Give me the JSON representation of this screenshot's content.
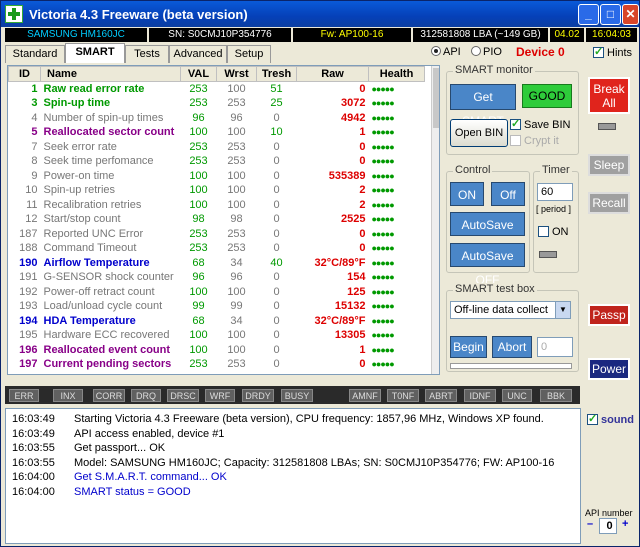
{
  "title": "Victoria 4.3 Freeware (beta version)",
  "window_buttons": {
    "minimize": "_",
    "maximize": "□",
    "close": "✕"
  },
  "infobar": {
    "model": "SAMSUNG HM160JC",
    "serial": "SN: S0CMJ10P354776",
    "firmware": "Fw: AP100-16",
    "capacity": "312581808 LBA (~149 GB)",
    "date": "04.02",
    "time": "16:04:03"
  },
  "tabs": [
    "Standard",
    "SMART",
    "Tests",
    "Advanced",
    "Setup"
  ],
  "api_radio": {
    "api": "API",
    "pio": "PIO"
  },
  "device": "Device 0",
  "hints": "Hints",
  "table": {
    "headers": [
      "ID",
      "Name",
      "VAL",
      "Wrst",
      "Tresh",
      "Raw",
      "Health"
    ],
    "rows": [
      {
        "id": "1",
        "name": "Raw read error rate",
        "val": "253",
        "wrst": "100",
        "tresh": "51",
        "raw": "0",
        "health": "●●●●●",
        "style": "green"
      },
      {
        "id": "3",
        "name": "Spin-up time",
        "val": "253",
        "wrst": "253",
        "tresh": "25",
        "raw": "3072",
        "health": "●●●●●",
        "style": "green"
      },
      {
        "id": "4",
        "name": "Number of spin-up times",
        "val": "96",
        "wrst": "96",
        "tresh": "0",
        "raw": "4942",
        "health": "●●●●●",
        "style": "grey"
      },
      {
        "id": "5",
        "name": "Reallocated sector count",
        "val": "100",
        "wrst": "100",
        "tresh": "10",
        "raw": "1",
        "health": "●●●●●",
        "style": "purple"
      },
      {
        "id": "7",
        "name": "Seek error rate",
        "val": "253",
        "wrst": "253",
        "tresh": "0",
        "raw": "0",
        "health": "●●●●●",
        "style": "grey"
      },
      {
        "id": "8",
        "name": "Seek time perfomance",
        "val": "253",
        "wrst": "253",
        "tresh": "0",
        "raw": "0",
        "health": "●●●●●",
        "style": "grey"
      },
      {
        "id": "9",
        "name": "Power-on time",
        "val": "100",
        "wrst": "100",
        "tresh": "0",
        "raw": "535389",
        "health": "●●●●●",
        "style": "grey"
      },
      {
        "id": "10",
        "name": "Spin-up retries",
        "val": "100",
        "wrst": "100",
        "tresh": "0",
        "raw": "2",
        "health": "●●●●●",
        "style": "grey"
      },
      {
        "id": "11",
        "name": "Recalibration retries",
        "val": "100",
        "wrst": "100",
        "tresh": "0",
        "raw": "2",
        "health": "●●●●●",
        "style": "grey"
      },
      {
        "id": "12",
        "name": "Start/stop count",
        "val": "98",
        "wrst": "98",
        "tresh": "0",
        "raw": "2525",
        "health": "●●●●●",
        "style": "grey"
      },
      {
        "id": "187",
        "name": "Reported UNC Error",
        "val": "253",
        "wrst": "253",
        "tresh": "0",
        "raw": "0",
        "health": "●●●●●",
        "style": "grey"
      },
      {
        "id": "188",
        "name": "Command Timeout",
        "val": "253",
        "wrst": "253",
        "tresh": "0",
        "raw": "0",
        "health": "●●●●●",
        "style": "grey"
      },
      {
        "id": "190",
        "name": "Airflow Temperature",
        "val": "68",
        "wrst": "34",
        "tresh": "40",
        "raw": "32°C/89°F",
        "health": "●●●●●",
        "style": "blue"
      },
      {
        "id": "191",
        "name": "G-SENSOR shock counter",
        "val": "96",
        "wrst": "96",
        "tresh": "0",
        "raw": "154",
        "health": "●●●●●",
        "style": "grey"
      },
      {
        "id": "192",
        "name": "Power-off retract count",
        "val": "100",
        "wrst": "100",
        "tresh": "0",
        "raw": "125",
        "health": "●●●●●",
        "style": "grey"
      },
      {
        "id": "193",
        "name": "Load/unload cycle count",
        "val": "99",
        "wrst": "99",
        "tresh": "0",
        "raw": "15132",
        "health": "●●●●●",
        "style": "grey"
      },
      {
        "id": "194",
        "name": "HDA Temperature",
        "val": "68",
        "wrst": "34",
        "tresh": "0",
        "raw": "32°C/89°F",
        "health": "●●●●●",
        "style": "blue"
      },
      {
        "id": "195",
        "name": "Hardware ECC recovered",
        "val": "100",
        "wrst": "100",
        "tresh": "0",
        "raw": "13305",
        "health": "●●●●●",
        "style": "grey"
      },
      {
        "id": "196",
        "name": "Reallocated event count",
        "val": "100",
        "wrst": "100",
        "tresh": "0",
        "raw": "1",
        "health": "●●●●●",
        "style": "purple"
      },
      {
        "id": "197",
        "name": "Current pending sectors",
        "val": "253",
        "wrst": "253",
        "tresh": "0",
        "raw": "0",
        "health": "●●●●●",
        "style": "purple"
      }
    ]
  },
  "smart_monitor": {
    "label": "SMART monitor",
    "get_smart": "Get SMART",
    "status": "GOOD",
    "open_bin": "Open BIN",
    "save_bin": "Save BIN",
    "crypt_it": "Crypt it"
  },
  "control": {
    "label": "Control",
    "on": "ON",
    "off": "Off",
    "autosave_on": "AutoSave ON",
    "autosave_off": "AutoSave OFF"
  },
  "timer": {
    "label": "Timer",
    "value": "60",
    "period": "[ period ]",
    "on": "ON"
  },
  "test_box": {
    "label": "SMART test box",
    "selected": "Off-line data collect",
    "begin": "Begin",
    "abort": "Abort",
    "number": "0"
  },
  "side_buttons": {
    "break_all": "Break All",
    "sleep": "Sleep",
    "recall": "Recall",
    "passp": "Passp",
    "power": "Power"
  },
  "status_flags": [
    "ERR",
    "INX",
    "CORR",
    "DRQ",
    "DRSC",
    "WRF",
    "DRDY",
    "BUSY",
    "AMNF",
    "T0NF",
    "ABRT",
    "IDNF",
    "UNC",
    "BBK"
  ],
  "log": [
    {
      "time": "16:03:49",
      "text": "Starting Victoria 4.3 Freeware (beta version), CPU frequency: 1857,96 MHz, Windows XP found.",
      "color": "#000"
    },
    {
      "time": "16:03:49",
      "text": "API access enabled, device #1",
      "color": "#000"
    },
    {
      "time": "16:03:55",
      "text": "Get passport... OK",
      "color": "#000"
    },
    {
      "time": "16:03:55",
      "text": "Model: SAMSUNG HM160JC; Capacity: 312581808 LBAs; SN: S0CMJ10P354776; FW: AP100-16",
      "color": "#000"
    },
    {
      "time": "16:04:00",
      "text": "Get S.M.A.R.T. command... OK",
      "color": "#00c"
    },
    {
      "time": "16:04:00",
      "text": "SMART status = GOOD",
      "color": "#00c"
    }
  ],
  "sound": "sound",
  "api_number": {
    "label": "API number",
    "value": "0",
    "minus": "–",
    "plus": "+"
  }
}
